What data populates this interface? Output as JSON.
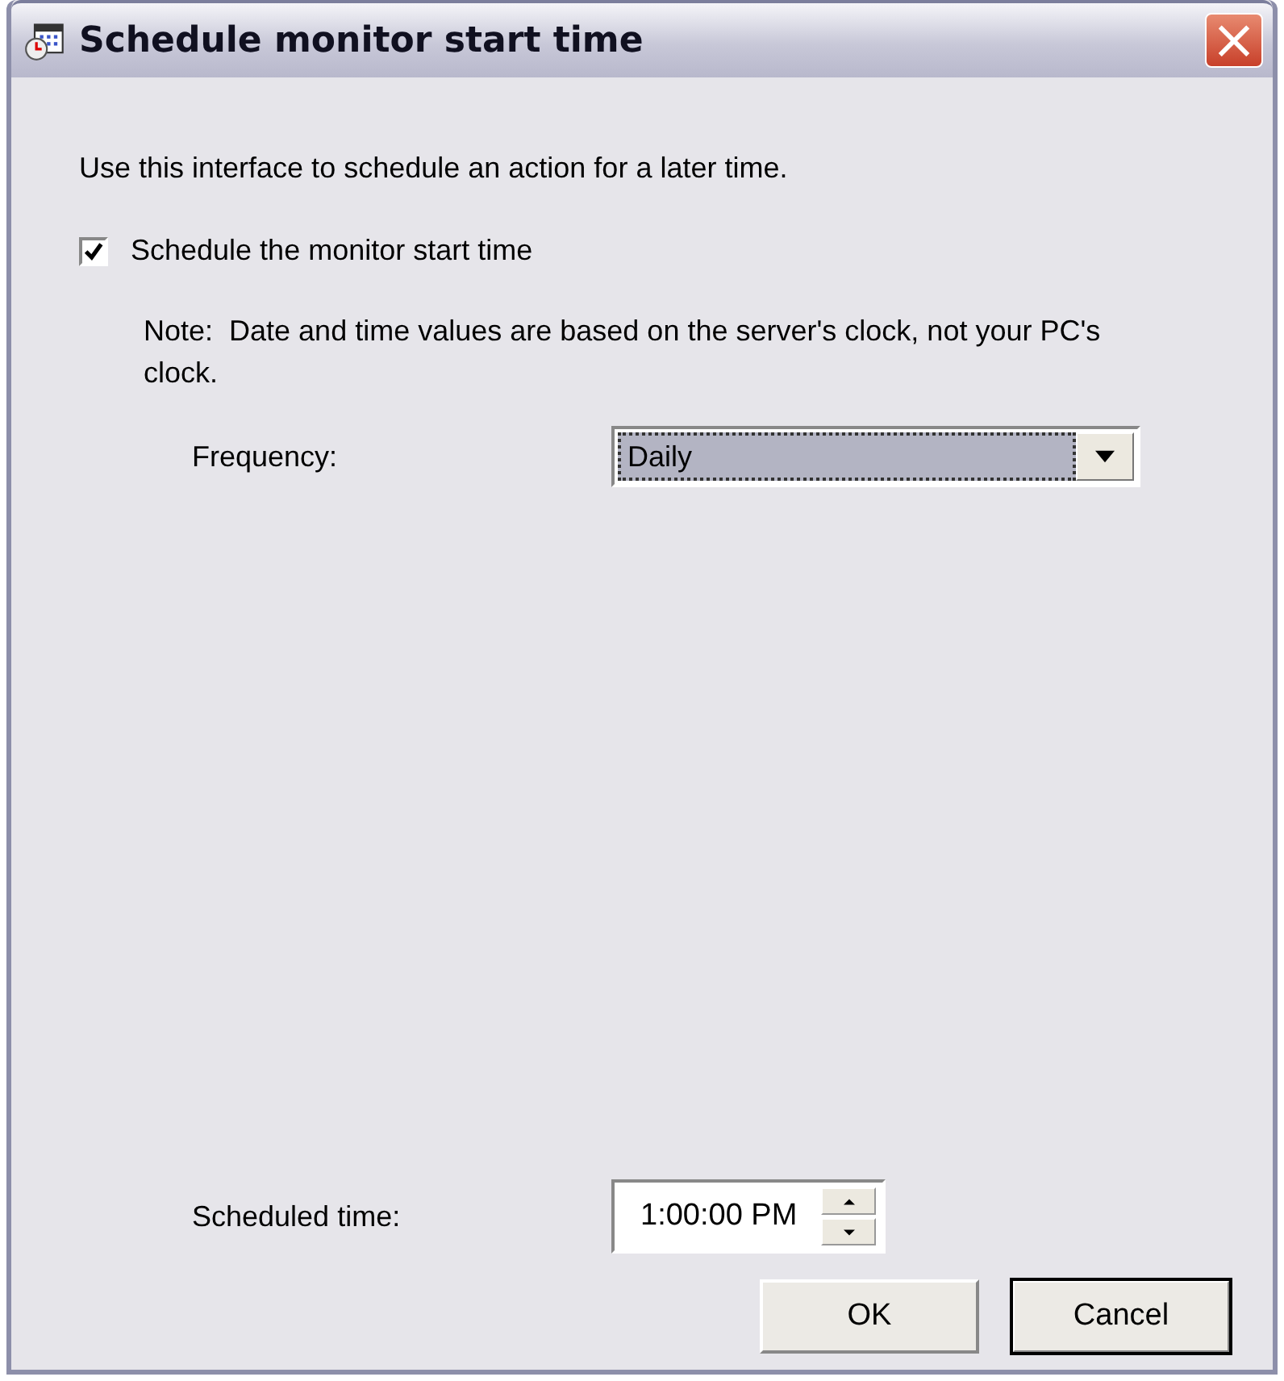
{
  "window": {
    "title": "Schedule monitor start time",
    "close": "×"
  },
  "intro": "Use this interface to schedule an action for a later time.",
  "schedule_checkbox": {
    "label": "Schedule the monitor start time",
    "checked": true
  },
  "note": "Note:  Date and time values are based on the server's clock, not your PC's clock.",
  "frequency": {
    "label": "Frequency:",
    "value": "Daily",
    "focused": true
  },
  "scheduled_time": {
    "label": "Scheduled time:",
    "value": "1:00:00 PM"
  },
  "buttons": [
    {
      "label": "OK",
      "default": false
    },
    {
      "label": "Cancel",
      "default": true
    }
  ]
}
